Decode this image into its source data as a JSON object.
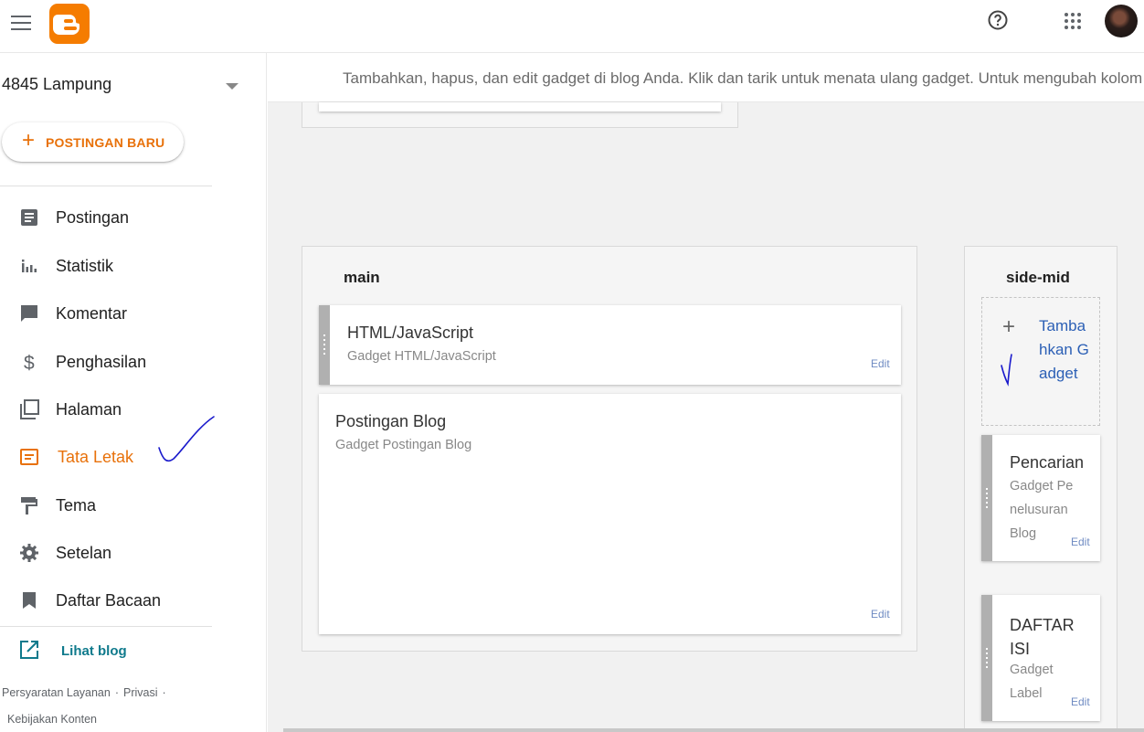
{
  "topbar": {
    "menu_icon": "hamburger-menu-icon",
    "logo_icon": "blogger-logo-icon",
    "help_icon": "help-circle-icon",
    "apps_icon": "apps-grid-icon",
    "avatar": "user-avatar"
  },
  "sidebar": {
    "blog_name": "4845 Lampung",
    "new_post_label": "POSTINGAN BARU",
    "items": [
      {
        "label": "Postingan",
        "icon": "posts-icon"
      },
      {
        "label": "Statistik",
        "icon": "stats-icon"
      },
      {
        "label": "Komentar",
        "icon": "comment-icon"
      },
      {
        "label": "Penghasilan",
        "icon": "dollar-icon"
      },
      {
        "label": "Halaman",
        "icon": "pages-icon"
      },
      {
        "label": "Tata Letak",
        "icon": "layout-icon",
        "active": true
      },
      {
        "label": "Tema",
        "icon": "paint-roller-icon"
      },
      {
        "label": "Setelan",
        "icon": "gear-icon"
      },
      {
        "label": "Daftar Bacaan",
        "icon": "bookmark-icon"
      }
    ],
    "view_blog_label": "Lihat blog",
    "footer": {
      "terms": "Persyaratan Layanan",
      "sep1": "·",
      "privacy": "Privasi",
      "sep2": "·",
      "content_policy": "Kebijakan Konten"
    }
  },
  "main": {
    "info_text": "Tambahkan, hapus, dan edit gadget di blog Anda. Klik dan tarik untuk menata ulang gadget. Untuk mengubah kolom dan lebar, gunakan",
    "sections": {
      "main": {
        "title": "main",
        "gadgets": [
          {
            "title": "HTML/JavaScript",
            "subtitle": "Gadget HTML/JavaScript",
            "edit": "Edit"
          },
          {
            "title": "Postingan Blog",
            "subtitle": "Gadget Postingan Blog",
            "edit": "Edit"
          }
        ]
      },
      "side_mid": {
        "title": "side-mid",
        "add_gadget_label": "Tambahkan Gadget",
        "gadgets": [
          {
            "title": "Pencarian",
            "subtitle": "Gadget Penelusuran Blog",
            "edit": "Edit"
          },
          {
            "title": "DAFTAR ISI",
            "subtitle": "Gadget Label",
            "edit": "Edit"
          }
        ]
      }
    }
  },
  "colors": {
    "accent": "#e8710a",
    "link": "#2b5fb5",
    "annotation": "#1a1acc"
  }
}
